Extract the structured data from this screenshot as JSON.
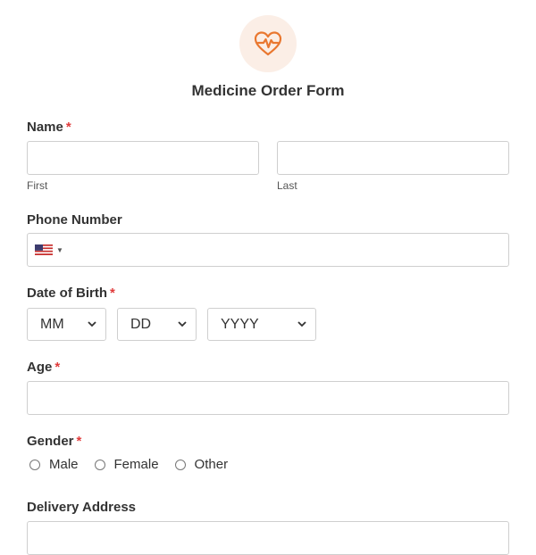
{
  "form": {
    "title": "Medicine Order Form",
    "logo_icon": "heartbeat-heart-icon",
    "accent_color": "#e9772f",
    "required_marker": "*",
    "required_color": "#e03b3b"
  },
  "fields": {
    "name": {
      "label": "Name",
      "first_sublabel": "First",
      "last_sublabel": "Last",
      "first_value": "",
      "last_value": ""
    },
    "phone": {
      "label": "Phone Number",
      "country_flag": "us-flag-icon",
      "value": ""
    },
    "dob": {
      "label": "Date of Birth",
      "month": "MM",
      "day": "DD",
      "year": "YYYY"
    },
    "age": {
      "label": "Age",
      "value": ""
    },
    "gender": {
      "label": "Gender",
      "options": [
        "Male",
        "Female",
        "Other"
      ]
    },
    "address": {
      "label": "Delivery Address"
    }
  }
}
